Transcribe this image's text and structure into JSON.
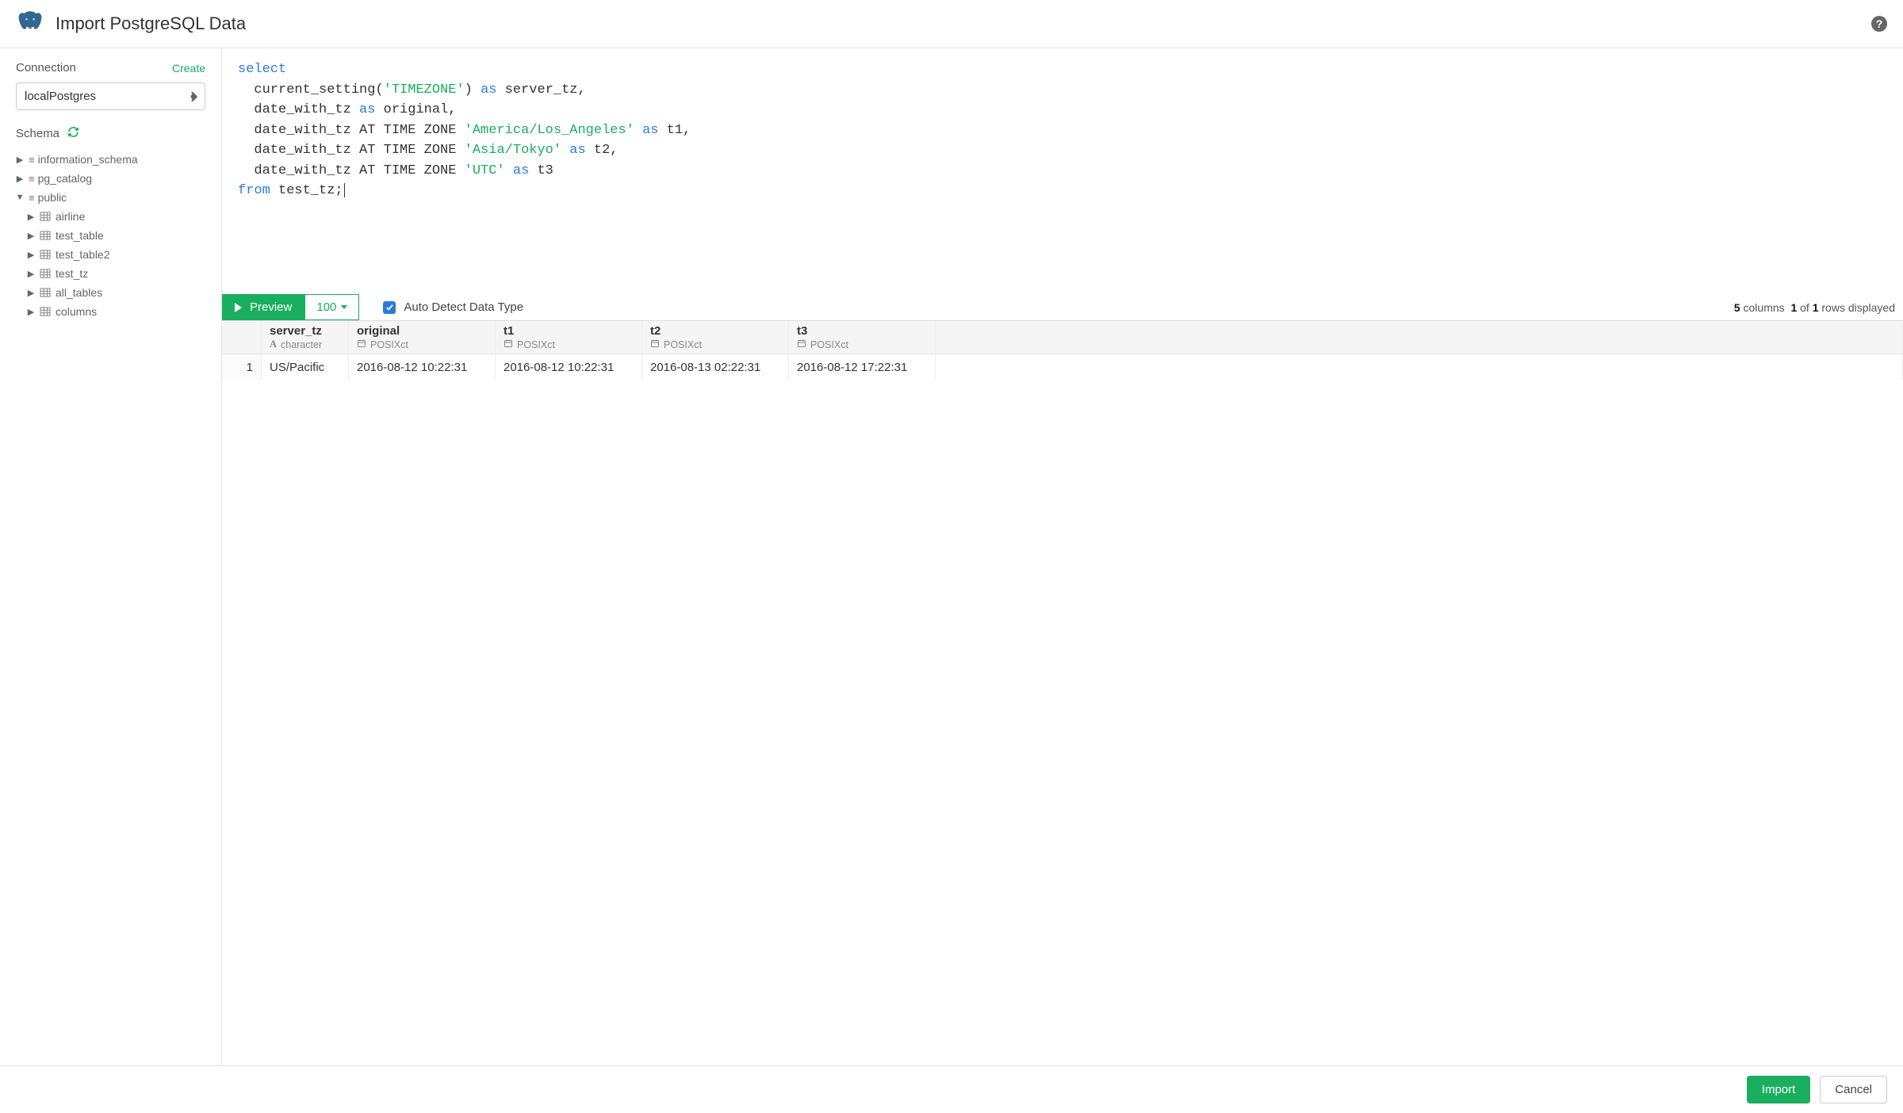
{
  "header": {
    "title": "Import PostgreSQL Data"
  },
  "sidebar": {
    "connection_label": "Connection",
    "create_label": "Create",
    "connection_value": "localPostgres",
    "schema_label": "Schema",
    "tree": [
      {
        "label": "information_schema",
        "type": "schema"
      },
      {
        "label": "pg_catalog",
        "type": "schema"
      },
      {
        "label": "public",
        "type": "schema",
        "expanded": true
      },
      {
        "label": "airline",
        "type": "table",
        "indent": 1
      },
      {
        "label": "test_table",
        "type": "table",
        "indent": 1
      },
      {
        "label": "test_table2",
        "type": "table",
        "indent": 1
      },
      {
        "label": "test_tz",
        "type": "table",
        "indent": 1
      },
      {
        "label": "all_tables",
        "type": "table",
        "indent": 1
      },
      {
        "label": "columns",
        "type": "table",
        "indent": 1
      }
    ]
  },
  "editor": {
    "lines": [
      [
        {
          "t": "select",
          "c": "kw"
        }
      ],
      [
        {
          "t": "  current_setting("
        },
        {
          "t": "'TIMEZONE'",
          "c": "str"
        },
        {
          "t": ") "
        },
        {
          "t": "as",
          "c": "kw"
        },
        {
          "t": " server_tz,"
        }
      ],
      [
        {
          "t": "  date_with_tz "
        },
        {
          "t": "as",
          "c": "kw"
        },
        {
          "t": " original,"
        }
      ],
      [
        {
          "t": "  date_with_tz AT TIME ZONE "
        },
        {
          "t": "'America/Los_Angeles'",
          "c": "str"
        },
        {
          "t": " "
        },
        {
          "t": "as",
          "c": "kw"
        },
        {
          "t": " t1,"
        }
      ],
      [
        {
          "t": "  date_with_tz AT TIME ZONE "
        },
        {
          "t": "'Asia/Tokyo'",
          "c": "str"
        },
        {
          "t": " "
        },
        {
          "t": "as",
          "c": "kw"
        },
        {
          "t": " t2,"
        }
      ],
      [
        {
          "t": "  date_with_tz AT TIME ZONE "
        },
        {
          "t": "'UTC'",
          "c": "str"
        },
        {
          "t": " "
        },
        {
          "t": "as",
          "c": "kw"
        },
        {
          "t": " t3"
        }
      ],
      [
        {
          "t": "from",
          "c": "kw"
        },
        {
          "t": " test_tz;"
        }
      ]
    ]
  },
  "toolbar": {
    "preview_label": "Preview",
    "limit_label": "100",
    "auto_detect_label": "Auto Detect Data Type",
    "auto_detect_checked": true,
    "result_columns": "5",
    "result_columns_word": "columns",
    "result_row_from": "1",
    "result_row_of_word": "of",
    "result_row_total": "1",
    "result_rows_tail": "rows displayed"
  },
  "results": {
    "columns": [
      {
        "name": "server_tz",
        "type": "character",
        "type_icon": "A"
      },
      {
        "name": "original",
        "type": "POSIXct",
        "type_icon": "cal"
      },
      {
        "name": "t1",
        "type": "POSIXct",
        "type_icon": "cal"
      },
      {
        "name": "t2",
        "type": "POSIXct",
        "type_icon": "cal"
      },
      {
        "name": "t3",
        "type": "POSIXct",
        "type_icon": "cal"
      }
    ],
    "rows": [
      {
        "n": "1",
        "cells": [
          "US/Pacific",
          "2016-08-12 10:22:31",
          "2016-08-12 10:22:31",
          "2016-08-13 02:22:31",
          "2016-08-12 17:22:31"
        ]
      }
    ]
  },
  "footer": {
    "import_label": "Import",
    "cancel_label": "Cancel"
  }
}
